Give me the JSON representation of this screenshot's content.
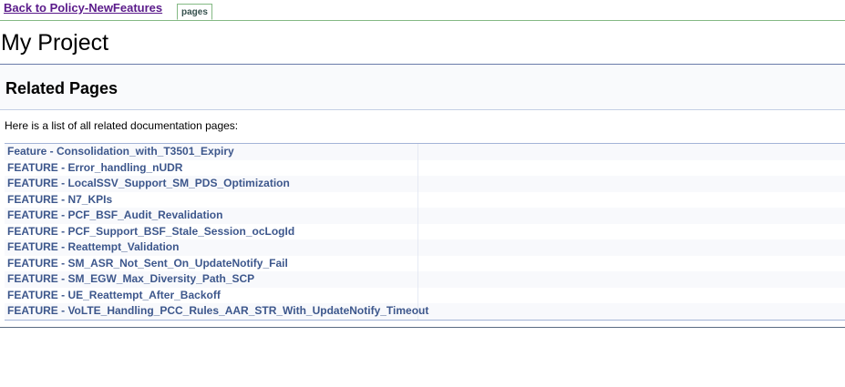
{
  "nav": {
    "back_link": "Back to Policy-NewFeatures",
    "tab_label": "pages"
  },
  "project": {
    "title": "My Project"
  },
  "header": {
    "title": "Related Pages"
  },
  "intro": "Here is a list of all related documentation pages:",
  "pages": [
    "Feature - Consolidation_with_T3501_Expiry",
    "FEATURE - Error_handling_nUDR",
    "FEATURE - LocalSSV_Support_SM_PDS_Optimization",
    "FEATURE - N7_KPIs",
    "FEATURE - PCF_BSF_Audit_Revalidation",
    "FEATURE - PCF_Support_BSF_Stale_Session_ocLogId",
    "FEATURE - Reattempt_Validation",
    "FEATURE - SM_ASR_Not_Sent_On_UpdateNotify_Fail",
    "FEATURE - SM_EGW_Max_Diversity_Path_SCP",
    "FEATURE - UE_Reattempt_After_Backoff",
    "FEATURE - VoLTE_Handling_PCC_Rules_AAR_STR_With_UpdateNotify_Timeout"
  ],
  "colors": {
    "link": "#3d578c",
    "back_link": "#5a1a8a",
    "tab_border": "#84b984",
    "title_rule": "#6a7ba9",
    "row_alt": "#f8f9fc"
  }
}
